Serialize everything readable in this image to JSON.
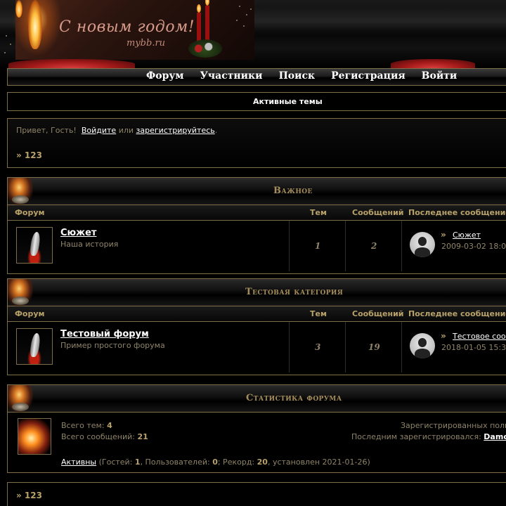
{
  "banner": {
    "greeting": "С новым годом!",
    "site": "mybb.ru"
  },
  "nav": {
    "items": [
      "Форум",
      "Участники",
      "Поиск",
      "Регистрация",
      "Войти"
    ]
  },
  "active_topics": "Активные темы",
  "welcome": {
    "prefix": "Привет, Гость!",
    "login": "Войдите",
    "or": "или",
    "register": "зарегистрируйтесь",
    "suffix": ".",
    "crumb": "» 123"
  },
  "columns": {
    "forum": "Форум",
    "topics": "Тем",
    "posts": "Сообщений",
    "last_post": "Последнее сообщение"
  },
  "categories": [
    {
      "title": "Важное",
      "forum": {
        "name": "Сюжет",
        "description": "Наша история",
        "topics": "1",
        "posts": "2",
        "last_post_link": "Сюжет",
        "last_post_date": "2009-03-02 18:0"
      }
    },
    {
      "title": "Тестовая категория",
      "forum": {
        "name": "Тестовый форум",
        "description": "Пример простого форума",
        "topics": "3",
        "posts": "19",
        "last_post_link": "Тестовое сооб",
        "last_post_date": "2018-01-05 15:3"
      }
    }
  ],
  "stats": {
    "title": "Статистика форума",
    "total_topics_label": "Всего тем:",
    "total_topics": "4",
    "total_posts_label": "Всего сообщений:",
    "total_posts": "21",
    "registered_users_label": "Зарегистрированных поль",
    "last_registered_label": "Последним зарегистрировался:",
    "last_registered_user": "Damo",
    "online_link": "Активны",
    "online_prefix": "(Гостей:",
    "guests": "1",
    "users_label": ", Пользователей:",
    "users": "0",
    "record_label": "; Рекорд:",
    "record": "20",
    "record_date_label": ", установлен 2021-01-26)"
  },
  "bottom_crumb": "» 123",
  "colors": {
    "background": "#000000",
    "border": "#7f6e48",
    "accent_gold": "#b8a26a",
    "text_muted": "#8f8468",
    "link": "#ffffff"
  }
}
